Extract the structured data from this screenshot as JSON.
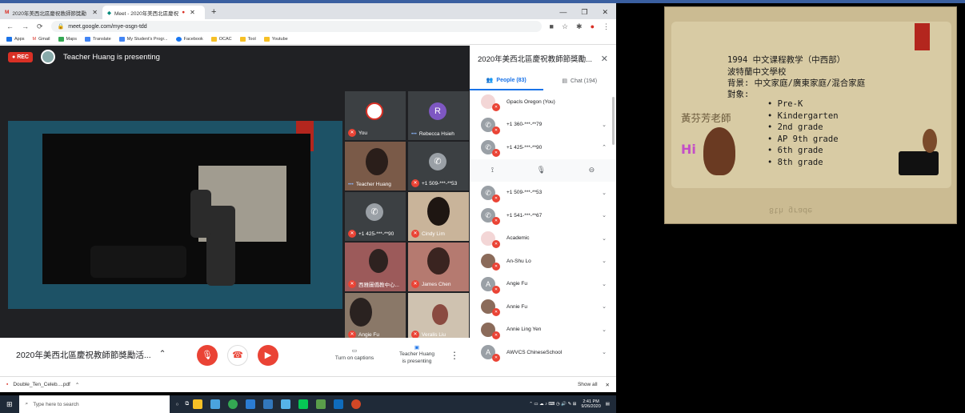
{
  "browser": {
    "tabs": [
      {
        "label": "2020年美西北區慶祝教師節獎勵",
        "icon": "gmail-icon"
      },
      {
        "label": "Meet - 2020年美西北區慶祝",
        "icon": "meet-icon"
      }
    ],
    "url": "meet.google.com/mye-osgn-tdd",
    "bookmarks": [
      "Apps",
      "Gmail",
      "Maps",
      "Translate",
      "My Student's Progr...",
      "Facebook",
      "OCAC",
      "Tool",
      "Youtube"
    ]
  },
  "meet": {
    "rec_label": "REC",
    "presenting_banner": "Teacher Huang is presenting",
    "meeting_name": "2020年美西北區慶祝教師節獎勵活...",
    "tiles": [
      {
        "name": "You",
        "muted": true
      },
      {
        "name": "Rebecca Hsieh",
        "initial": "R",
        "muted": false
      },
      {
        "name": "Teacher Huang",
        "muted": false
      },
      {
        "name": "+1 509-***-**53",
        "muted": true
      },
      {
        "name": "+1 425-***-**90",
        "muted": true
      },
      {
        "name": "Cindy Lim",
        "muted": true
      },
      {
        "name": "西雅圖僑教中心...",
        "muted": true
      },
      {
        "name": "James Chen",
        "muted": true
      },
      {
        "name": "Angie Fu",
        "muted": true
      },
      {
        "name": "Veralis Liu",
        "muted": true
      }
    ],
    "controls": {
      "captions_label": "Turn on captions",
      "presenting_label": "Teacher Huang\nis presenting"
    }
  },
  "panel": {
    "title": "2020年美西北區慶祝教師節獎勵...",
    "people_tab": "People (83)",
    "chat_tab": "Chat (194)",
    "people": [
      {
        "name": "Gpacls Oregon (You)",
        "avatar": "logo"
      },
      {
        "name": "+1 360-***-**79",
        "avatar": "phone"
      },
      {
        "name": "+1 425-***-**90",
        "avatar": "phone",
        "expanded": true
      },
      {
        "name": "+1 509-***-**53",
        "avatar": "phone"
      },
      {
        "name": "+1 541-***-**67",
        "avatar": "phone"
      },
      {
        "name": "Academic",
        "avatar": "logo"
      },
      {
        "name": "An-Shu Lo",
        "avatar": "photo"
      },
      {
        "name": "Angie Fu",
        "avatar": "A"
      },
      {
        "name": "Annie Fu",
        "avatar": "photo"
      },
      {
        "name": "Annie Ling Yen",
        "avatar": "photo"
      },
      {
        "name": "AWVCS ChineseSchool",
        "avatar": "A"
      }
    ]
  },
  "download": {
    "file": "Double_Ten_Celeb....pdf",
    "show_all": "Show all"
  },
  "taskbar": {
    "search_placeholder": "Type here to search",
    "time": "2:41 PM",
    "date": "9/26/2020"
  },
  "slide": {
    "line1": "1994 中文课程教学（中西部）",
    "line2": "波特蘭中文學校",
    "line3": "背景: 中文家庭/廣東家庭/混合家庭",
    "line4": "對象:",
    "teacher": "黃芬芳老師",
    "hi": "Hi",
    "bullets": [
      "Pre-K",
      "Kindergarten",
      "2nd grade",
      "AP 9th grade",
      "6th grade",
      "8th grade"
    ]
  },
  "colors": {
    "meet_bg": "#202124",
    "red": "#ea4335",
    "accent": "#1a73e8"
  }
}
